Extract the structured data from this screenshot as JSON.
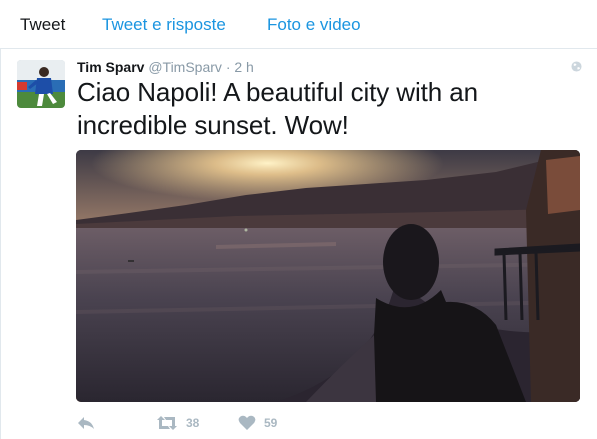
{
  "tabs": [
    {
      "label": "Tweet"
    },
    {
      "label": "Tweet e risposte"
    },
    {
      "label": "Foto e video"
    }
  ],
  "tweet": {
    "author_name": "Tim Sparv",
    "author_handle": "@TimSparv",
    "separator": "·",
    "time": "2 h",
    "text": "Ciao Napoli! A beautiful city with an incredible sunset. Wow!",
    "retweets": "38",
    "likes": "59"
  },
  "icons": {
    "reply": "reply-icon",
    "retweet": "retweet-icon",
    "like": "heart-icon",
    "globe": "globe-icon"
  },
  "colors": {
    "link_blue": "#1b95e0",
    "action_gray": "#aab8c2",
    "text_dark": "#14171a"
  }
}
